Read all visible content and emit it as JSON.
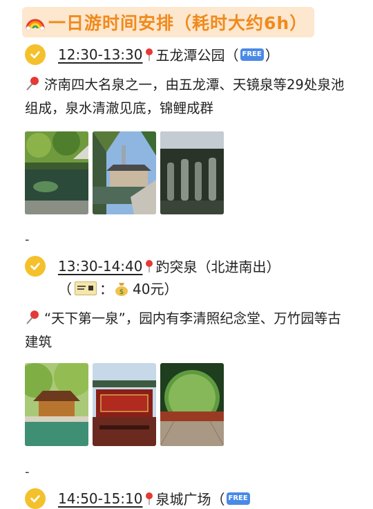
{
  "title": "一日游时间安排（耗时大约6h）",
  "items": [
    {
      "time": "12:30-13:30",
      "place": "五龙潭公园（",
      "place_end": "）",
      "badge": "FREE",
      "desc": "济南四大名泉之一，由五龙潭、天镜泉等29处泉池组成，泉水清澈见底，锦鲤成群"
    },
    {
      "time": "13:30-14:40",
      "place": "趵突泉（北进南出）",
      "sub_open": "（",
      "sub_colon": "：",
      "price": "40元）",
      "desc": "“天下第一泉”，园内有李清照纪念堂、万竹园等古建筑"
    },
    {
      "time": "14:50-15:10",
      "place": "泉城广场（",
      "badge": "FREE"
    }
  ],
  "separator": "-",
  "photos": {
    "p1": "garden-pond",
    "p2": "pavilion-lake",
    "p3": "rock-statues",
    "p4": "pavilion-trees",
    "p5": "gate-plaque",
    "p6": "bamboo-walkway"
  },
  "colors": {
    "accent": "#f08a1c",
    "title_bg": "#fde7cf",
    "check": "#f4c12d",
    "free": "#4a8ae6"
  }
}
